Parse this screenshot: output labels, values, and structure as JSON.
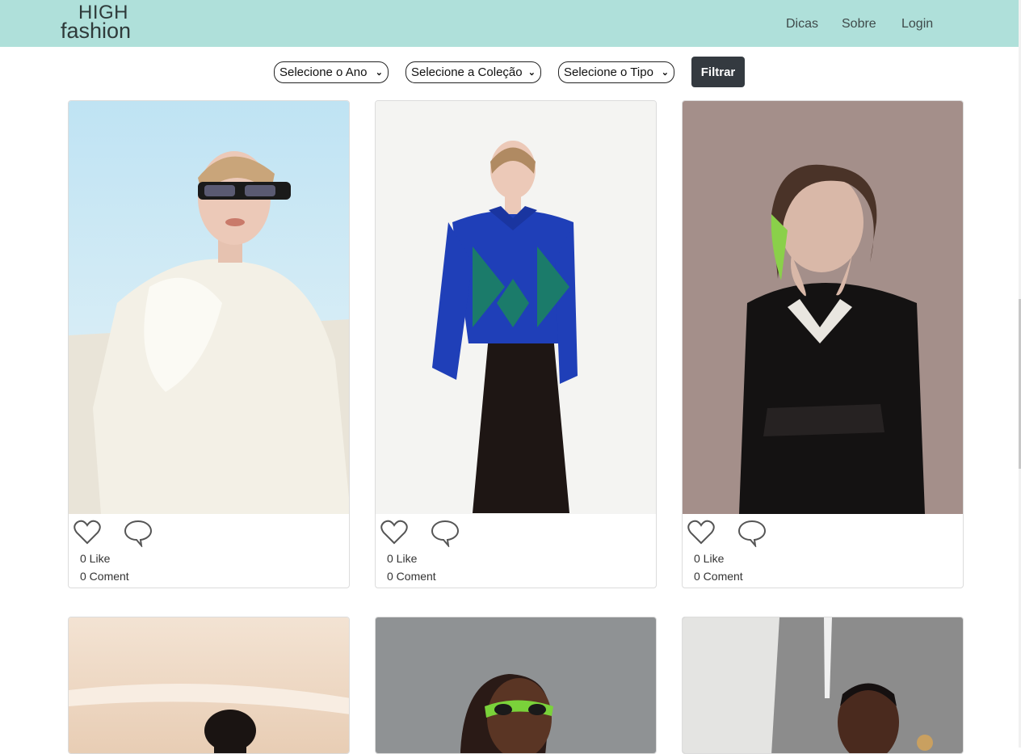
{
  "header": {
    "logo": {
      "line1": "HIGH",
      "line2": "fashion"
    },
    "nav": [
      {
        "label": "Dicas"
      },
      {
        "label": "Sobre"
      },
      {
        "label": "Login"
      }
    ]
  },
  "filters": {
    "year": "Selecione o Ano",
    "collection": "Selecione a Coleção",
    "type": "Selecione o Tipo",
    "button": "Filtrar"
  },
  "cards": [
    {
      "likes": "0 Like",
      "comments": "0 Coment",
      "photo": "woman-white-blazer-sunglasses"
    },
    {
      "likes": "0 Like",
      "comments": "0 Coment",
      "photo": "woman-blue-green-argyle-sweater"
    },
    {
      "likes": "0 Like",
      "comments": "0 Coment",
      "photo": "woman-black-coat-green-hair"
    },
    {
      "photo": "woman-braided-hair-beige"
    },
    {
      "photo": "woman-green-sunglasses-braids"
    },
    {
      "photo": "woman-short-hair-grey-wall"
    }
  ],
  "icons": [
    "heart-icon",
    "comment-bubble-icon"
  ],
  "colors": {
    "header": "#afe0da",
    "button": "#343a40"
  }
}
